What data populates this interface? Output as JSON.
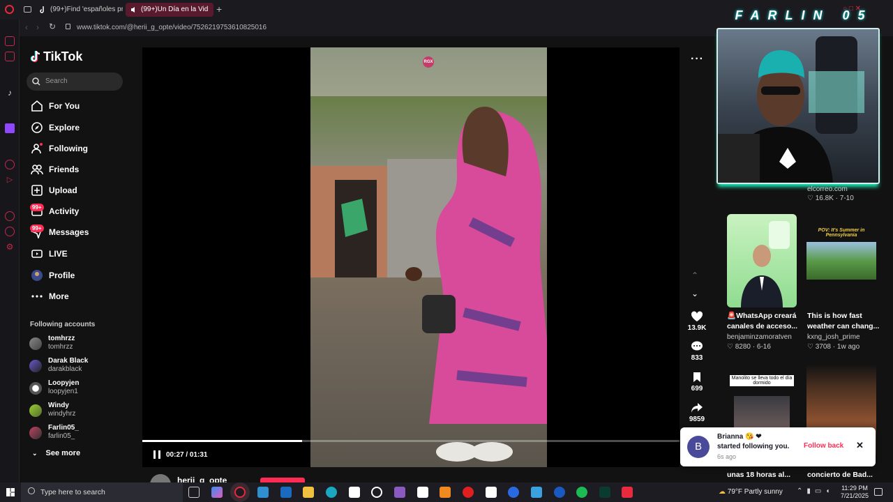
{
  "browser": {
    "tabs": [
      {
        "label": "(99+)Find 'españoles pro"
      },
      {
        "label": "(99+)Un Día en la Vid"
      }
    ],
    "url": "www.tiktok.com/@herii_g_opte/video/7526219753610825016"
  },
  "tiktok": {
    "logo": "TikTok",
    "search_placeholder": "Search",
    "nav": [
      {
        "label": "For You",
        "icon": "home-icon"
      },
      {
        "label": "Explore",
        "icon": "compass-icon"
      },
      {
        "label": "Following",
        "icon": "following-icon"
      },
      {
        "label": "Friends",
        "icon": "friends-icon"
      },
      {
        "label": "Upload",
        "icon": "upload-icon"
      },
      {
        "label": "Activity",
        "icon": "activity-icon",
        "badge": "99+"
      },
      {
        "label": "Messages",
        "icon": "messages-icon",
        "badge": "99+"
      },
      {
        "label": "LIVE",
        "icon": "live-icon"
      },
      {
        "label": "Profile",
        "icon": "profile-avatar"
      },
      {
        "label": "More",
        "icon": "more-dots-icon"
      }
    ],
    "following_title": "Following accounts",
    "following": [
      {
        "name": "tomhrzz",
        "handle": "tomhrzz"
      },
      {
        "name": "Darak Black",
        "handle": "darakblack"
      },
      {
        "name": "Loopyjen",
        "handle": "loopyjen1"
      },
      {
        "name": "Windy",
        "handle": "windyhrz"
      },
      {
        "name": "Farlin05_",
        "handle": "farlin05_"
      }
    ],
    "see_more": "See more",
    "video": {
      "time": "00:27 / 01:31",
      "progress": 0.297,
      "watermark": "RGX",
      "author": "herii_g_opte"
    },
    "actions": {
      "likes": "13.9K",
      "comments": "833",
      "saves": "699",
      "shares": "9859"
    }
  },
  "streamer": {
    "name": "FARLIN 05"
  },
  "recommended": [
    {
      "author": "elcorreo.com",
      "likes": "16.8K",
      "date": "7-10"
    },
    {
      "title": "🚨WhatsApp creará canales de acceso...",
      "author": "benjaminzamoratven",
      "likes": "8280",
      "date": "6-16"
    },
    {
      "title": "This is how fast weather can chang...",
      "author": "kxng_josh_prime",
      "likes": "3708",
      "date": "1w ago",
      "thumb_caption": "POV: It's Summer in Pennsylvania"
    },
    {
      "title": "unas 18 horas al...",
      "thumb_caption": "Manolito se lleva todo el día dormido"
    },
    {
      "title": "concierto de Bad..."
    }
  ],
  "toast": {
    "avatar_letter": "B",
    "name": "Brianna",
    "message": "started following you.",
    "time": "6s ago",
    "action": "Follow back"
  },
  "taskbar": {
    "search_placeholder": "Type here to search",
    "weather": "79°F  Partly sunny",
    "time": "11:29 PM",
    "date": "7/21/2025"
  },
  "colors": {
    "accent": "#fe2c55",
    "bg": "#121212"
  }
}
